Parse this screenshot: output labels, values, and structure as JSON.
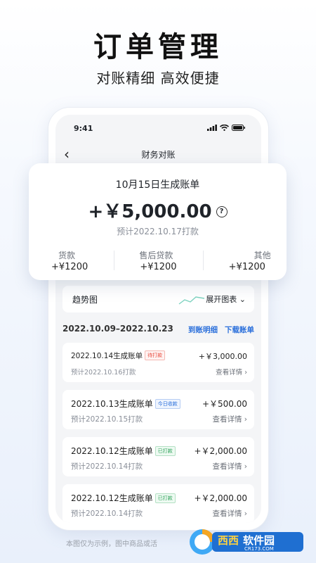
{
  "headline": "订单管理",
  "subline": "对账精细 高效便捷",
  "phone": {
    "time": "9:41",
    "nav_title": "财务对账",
    "trend_label": "趋势图",
    "trend_expand": "展开图表",
    "range": "2022.10.09–2022.10.23",
    "link_detail": "到账明细",
    "link_download": "下载账单",
    "records": [
      {
        "title": "2022.10.14生成账单",
        "badge": "待打款",
        "badge_color": "#e84a3c",
        "amount": "+￥3,000.00",
        "due": "预计2022.10.16打款",
        "detail": "查看详情"
      },
      {
        "title": "2022.10.13生成账单",
        "badge": "今日收款",
        "badge_color": "#2a6fdb",
        "amount": "+￥500.00",
        "due": "预计2022.10.15打款",
        "detail": "查看详情"
      },
      {
        "title": "2022.10.12生成账单",
        "badge": "已打款",
        "badge_color": "#2fa35a",
        "amount": "+￥2,000.00",
        "due": "预计2022.10.14打款",
        "detail": "查看详情"
      },
      {
        "title": "2022.10.12生成账单",
        "badge": "已打款",
        "badge_color": "#2fa35a",
        "amount": "+￥2,000.00",
        "due": "预计2022.10.14打款",
        "detail": "查看详情"
      }
    ]
  },
  "card": {
    "title": "10月15日生成账单",
    "amount": "+￥5,000.00",
    "due": "预计2022.10.17打款",
    "stats": [
      {
        "label": "货款",
        "value": "+¥1200"
      },
      {
        "label": "售后贷款",
        "value": "+¥1200"
      },
      {
        "label": "其他",
        "value": "+¥1200"
      }
    ]
  },
  "disclaimer": "本图仅为示例，图中商品或活",
  "watermark": {
    "brand": "西西软件园",
    "site": "CR173.COM"
  }
}
